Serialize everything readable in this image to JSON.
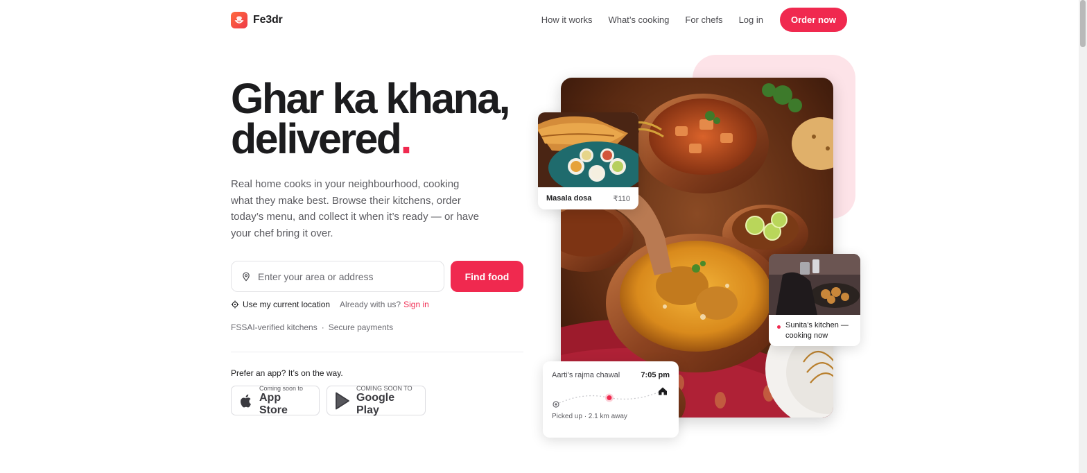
{
  "brand": {
    "name": "Fe3dr",
    "accent": "#f0294f"
  },
  "nav": {
    "items": [
      "How it works",
      "What’s cooking",
      "For chefs"
    ],
    "login": "Log in",
    "cta": "Order now"
  },
  "hero": {
    "headline_line1": "Ghar ka khana,",
    "headline_line2": "delivered",
    "headline_dot": ".",
    "description": "Real home cooks in your neighbourhood, cooking what they make best. Browse their kitchens, order today’s menu, and collect it when it’s ready — or have your chef bring it over.",
    "search": {
      "placeholder": "Enter your area or address",
      "value": "",
      "icon": "map-pin-icon"
    },
    "find_button": "Find food",
    "location_link": "Use my current location",
    "already_text": "Already with us?",
    "signin_link": "Sign in",
    "trust": [
      "FSSAI-verified kitchens",
      "·",
      "Secure payments"
    ]
  },
  "apps": {
    "title": "Prefer an app? It’s on the way.",
    "app_store": {
      "small": "Coming soon to",
      "large": "App Store",
      "icon": "apple-icon"
    },
    "google_play": {
      "small": "COMING SOON TO",
      "large": "Google Play",
      "icon": "google-play-icon"
    }
  },
  "cards": {
    "dish": {
      "name": "Masala dosa",
      "price": "₹110"
    },
    "kitchen": {
      "status": "Sunita’s kitchen — cooking now"
    },
    "tracking": {
      "order": "Aarti’s rajma chawal",
      "eta": "7:05 pm",
      "status": "Picked up · 2.1 km away",
      "progress": 0.5
    }
  }
}
